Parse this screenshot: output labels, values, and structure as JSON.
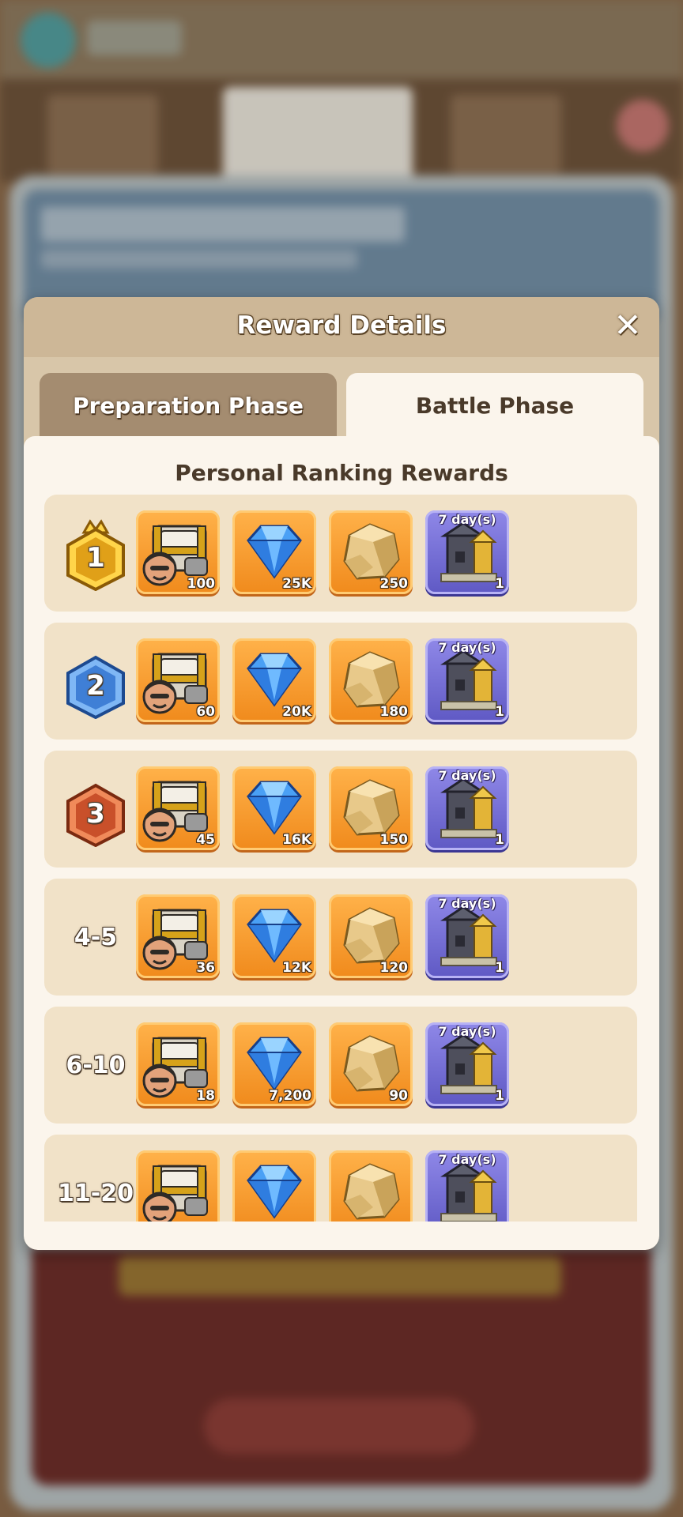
{
  "dialog": {
    "title": "Reward Details",
    "tabs": [
      {
        "label": "Preparation Phase",
        "active": false
      },
      {
        "label": "Battle Phase",
        "active": true
      }
    ],
    "section_title": "Personal Ranking Rewards"
  },
  "rows": [
    {
      "rank": "1",
      "rank_style": "gold-crown-badge",
      "chest_qty": "100",
      "gem_qty": "25K",
      "gold_qty": "250",
      "buff_duration": "7 day(s)",
      "buff_qty": "1"
    },
    {
      "rank": "2",
      "rank_style": "blue-hexagon-badge",
      "chest_qty": "60",
      "gem_qty": "20K",
      "gold_qty": "180",
      "buff_duration": "7 day(s)",
      "buff_qty": "1"
    },
    {
      "rank": "3",
      "rank_style": "bronze-hexagon-badge",
      "chest_qty": "45",
      "gem_qty": "16K",
      "gold_qty": "150",
      "buff_duration": "7 day(s)",
      "buff_qty": "1"
    },
    {
      "rank": "4-5",
      "chest_qty": "36",
      "gem_qty": "12K",
      "gold_qty": "120",
      "buff_duration": "7 day(s)",
      "buff_qty": "1"
    },
    {
      "rank": "6-10",
      "chest_qty": "18",
      "gem_qty": "7,200",
      "gold_qty": "90",
      "buff_duration": "7 day(s)",
      "buff_qty": "1"
    },
    {
      "rank": "11-20",
      "chest_qty": "",
      "gem_qty": "",
      "gold_qty": "",
      "buff_duration": "7 day(s)",
      "buff_qty": ""
    }
  ],
  "icons": {
    "chest": "hero-chest-icon",
    "gem": "blue-gem-icon",
    "gold": "gold-ore-icon",
    "buff": "fortress-buff-icon"
  },
  "colors": {
    "item_orange": "#f5a036",
    "item_purple": "#736ed8",
    "row_bg": "#f1e2c8",
    "header_bg": "#cdb797"
  }
}
